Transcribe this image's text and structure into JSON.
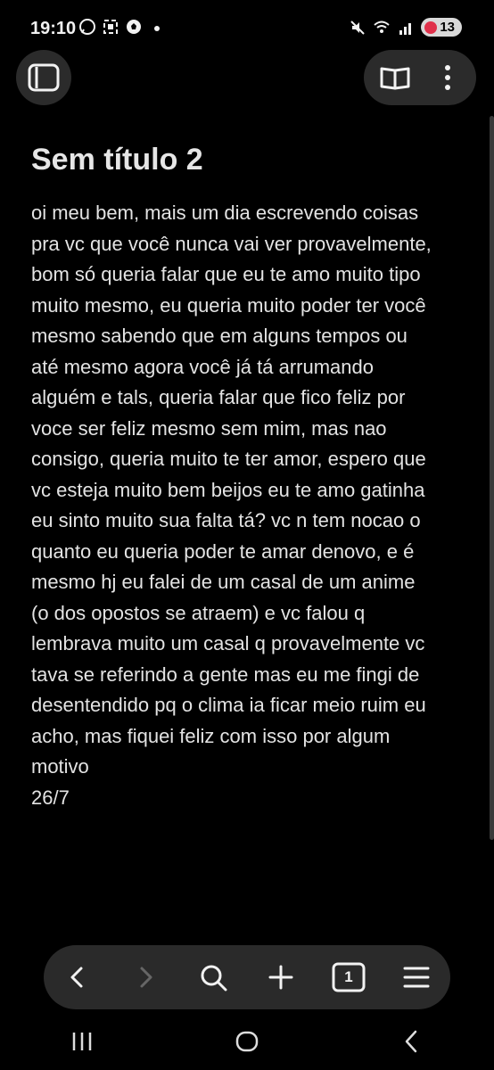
{
  "status_bar": {
    "time": "19:10",
    "notification_icons": [
      "whatsapp-icon",
      "screenshot-icon",
      "soccer-ball-icon",
      "dot-icon"
    ],
    "right_icons": [
      "mute-icon",
      "wifi-icon",
      "signal-icon"
    ],
    "battery_badge": "13"
  },
  "document": {
    "title": "Sem título 2",
    "body": "oi meu bem, mais um dia escrevendo coisas\npra vc que você nunca vai ver provavelmente,\nbom só queria falar que eu te amo muito tipo\nmuito mesmo, eu queria muito poder ter você\nmesmo sabendo que em alguns tempos ou\naté mesmo agora você já tá arrumando\nalguém e tals, queria falar que fico feliz por\nvoce ser feliz mesmo sem mim, mas nao\nconsigo, queria muito te ter amor, espero que\nvc esteja muito bem beijos eu te amo gatinha\neu sinto muito sua falta tá? vc n tem nocao o\nquanto eu queria poder te amar denovo, e é\nmesmo hj eu falei de um casal de um anime\n(o dos opostos se atraem) e vc falou q\nlembrava muito um casal q provavelmente vc\ntava se referindo a gente mas eu me fingi de\ndesentendido pq o clima ia ficar meio ruim eu\nacho, mas fiquei feliz com isso por algum\nmotivo\n26/7"
  },
  "toolbar": {
    "tab_count": "1"
  },
  "colors": {
    "background": "#000000",
    "surface": "#2a2a2a",
    "text": "#e3e3e3",
    "badge": "#d9d9d9",
    "battery_red": "#e0314b"
  }
}
